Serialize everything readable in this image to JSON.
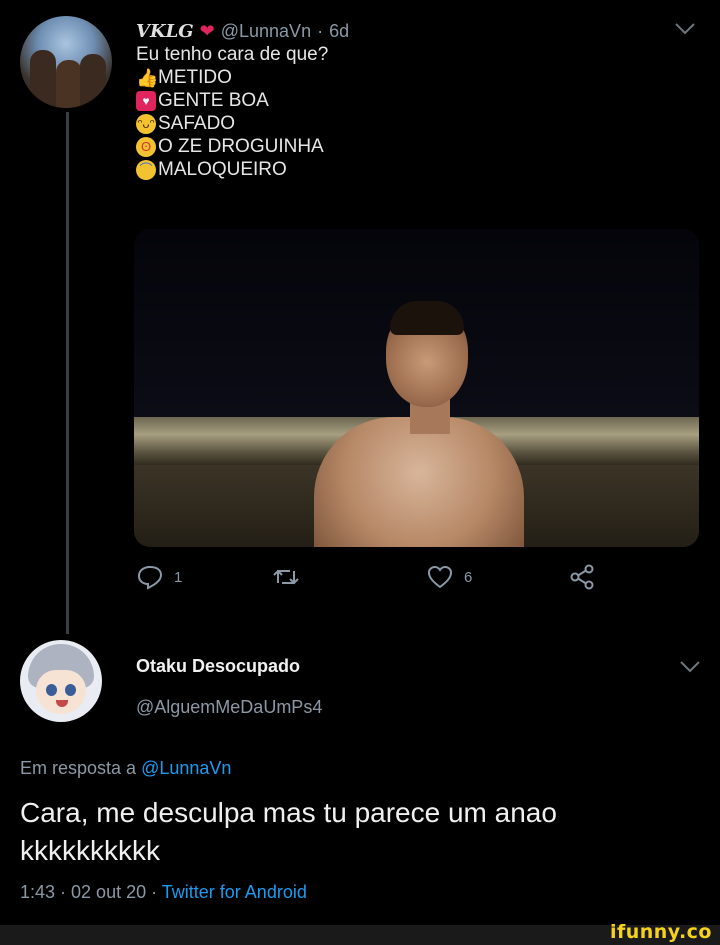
{
  "original_tweet": {
    "display_name": "VKLG",
    "heart_emoji": "❤",
    "handle": "@LunnaVn",
    "time_ago": "6d",
    "text_intro": "Eu tenho  cara de que?",
    "options": [
      {
        "icon": "thumbs-up-emoji",
        "glyph": "👍",
        "label": "METIDO"
      },
      {
        "icon": "heart-emoji",
        "glyph": "♥",
        "label": "GENTE BOA"
      },
      {
        "icon": "laughing-emoji",
        "glyph": "😂",
        "label": "SAFADO"
      },
      {
        "icon": "flushed-emoji",
        "glyph": "😳",
        "label": "O ZE DROGUINHA"
      },
      {
        "icon": "worried-emoji",
        "glyph": "😥",
        "label": "MALOQUEIRO"
      }
    ],
    "actions": {
      "reply_count": "1",
      "retweet_count": "",
      "like_count": "6"
    }
  },
  "reply_tweet": {
    "display_name": "Otaku Desocupado",
    "handle": "@AlguemMeDaUmPs4",
    "replying_prefix": "Em resposta a ",
    "replying_to": "@LunnaVn",
    "text": "Cara, me desculpa mas tu parece um anao kkkkkkkkkk",
    "time": "1:43 · 02 out 20 · ",
    "source": "Twitter for Android"
  },
  "watermark": "ifunny.co",
  "colors": {
    "background": "#000000",
    "link": "#1d9bf0",
    "muted": "#8b98a5",
    "watermark": "#f7d21b"
  }
}
